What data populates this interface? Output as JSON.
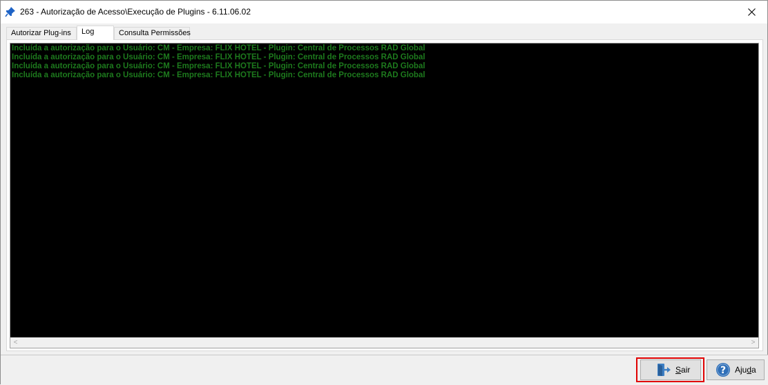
{
  "window": {
    "title": "263 - Autorização de Acesso\\Execução de Plugins - 6.11.06.02",
    "close_label": "×"
  },
  "tabs": [
    {
      "label": "Autorizar Plug-ins"
    },
    {
      "label": "Log",
      "active": true
    },
    {
      "label": "Consulta Permissões"
    }
  ],
  "log": {
    "lines": [
      "Incluída a autorização para o Usuário: CM - Empresa: FLIX HOTEL - Plugin: Central de Processos RAD Global",
      "Incluída a autorização para o Usuário: CM - Empresa: FLIX HOTEL - Plugin: Central de Processos RAD Global",
      "Incluída a autorização para o Usuário: CM - Empresa: FLIX HOTEL - Plugin: Central de Processos RAD Global",
      "Incluída a autorização para o Usuário: CM - Empresa: FLIX HOTEL - Plugin: Central de Processos RAD Global"
    ],
    "text_color": "#1d7a1d",
    "background": "#000000"
  },
  "footer": {
    "sair": {
      "first": "S",
      "rest": "air",
      "icon": "exit-door-icon"
    },
    "ajuda": {
      "first": "Aju",
      "underlined": "d",
      "rest": "a",
      "icon": "help-icon"
    },
    "highlight_color": "#e00000"
  }
}
